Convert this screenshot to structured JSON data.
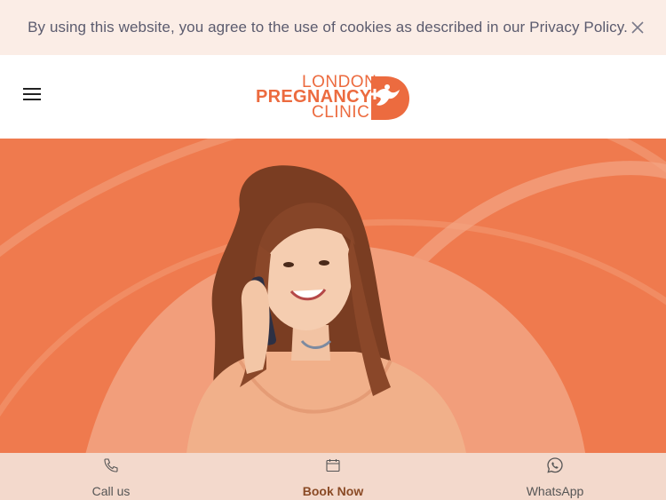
{
  "cookie_banner": {
    "message": "By using this website, you agree to the use of cookies as described in our Privacy Policy.",
    "close_icon": "close-icon"
  },
  "header": {
    "menu_icon": "hamburger-menu-icon",
    "logo": {
      "line1": "LONDON",
      "line2": "PREGNANCY",
      "line3": "CLINIC",
      "brand_color": "#ec6b3f"
    }
  },
  "hero": {
    "background_color": "#ef7a4e",
    "image": "woman-on-phone-photo"
  },
  "bottom_bar": {
    "items": [
      {
        "label": "Call us",
        "icon": "phone-icon"
      },
      {
        "label": "Book Now",
        "icon": "calendar-icon"
      },
      {
        "label": "WhatsApp",
        "icon": "whatsapp-icon"
      }
    ]
  }
}
